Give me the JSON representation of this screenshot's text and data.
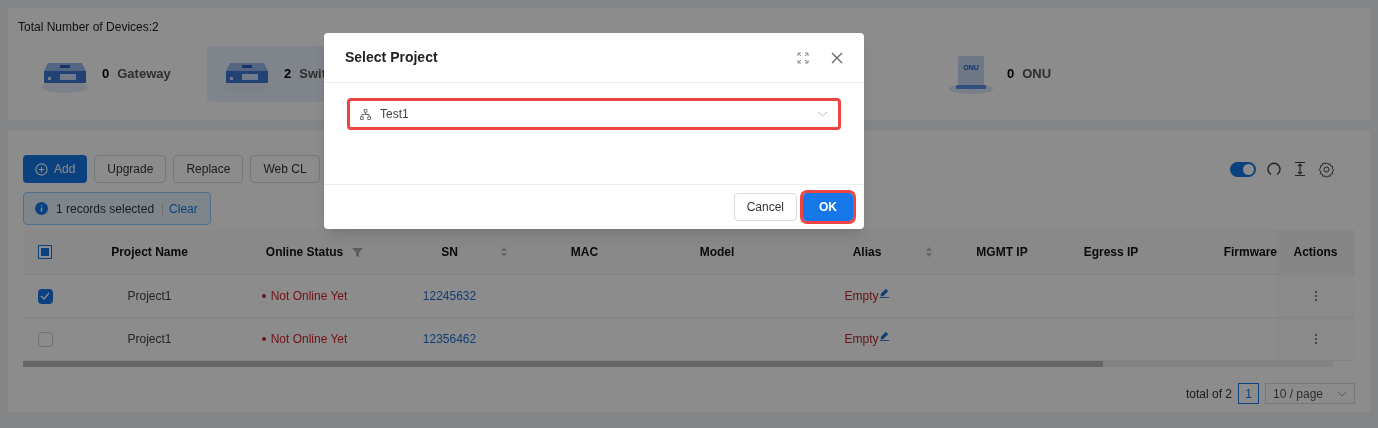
{
  "summary": {
    "title": "Total Number of Devices:2",
    "device_types": [
      {
        "kind": "gateway",
        "count": "0",
        "label": "Gateway",
        "selected": false
      },
      {
        "kind": "switch",
        "count": "2",
        "label": "Swit",
        "selected": true
      },
      {
        "kind": "onu",
        "count": "0",
        "label": "ONU",
        "selected": false,
        "icon_text": "ONU"
      }
    ]
  },
  "toolbar": {
    "buttons": [
      {
        "label": "Add",
        "kind": "primary"
      },
      {
        "label": "Upgrade",
        "kind": "default"
      },
      {
        "label": "Replace",
        "kind": "default"
      },
      {
        "label": "Web CL",
        "kind": "default"
      }
    ],
    "auto_refresh_on": true
  },
  "selection_bar": {
    "text": "1 records selected",
    "action": "Clear"
  },
  "table": {
    "header_checkbox_partial": true,
    "columns": [
      {
        "label": "Project Name",
        "sortable": false,
        "filterable": false
      },
      {
        "label": "Online Status",
        "sortable": false,
        "filterable": true
      },
      {
        "label": "SN",
        "sortable": true,
        "filterable": false
      },
      {
        "label": "MAC",
        "sortable": false,
        "filterable": false
      },
      {
        "label": "Model",
        "sortable": false,
        "filterable": false
      },
      {
        "label": "Alias",
        "sortable": true,
        "filterable": false
      },
      {
        "label": "MGMT IP",
        "sortable": false,
        "filterable": false
      },
      {
        "label": "Egress IP",
        "sortable": false,
        "filterable": false
      },
      {
        "label": "Firmware",
        "sortable": false,
        "filterable": false
      },
      {
        "label": "Actions",
        "sortable": false,
        "filterable": false
      }
    ],
    "rows": [
      {
        "checked": true,
        "project_name": "Project1",
        "online_status": "Not Online Yet",
        "sn": "12245632",
        "alias": "Empty"
      },
      {
        "checked": false,
        "project_name": "Project1",
        "online_status": "Not Online Yet",
        "sn": "12356462",
        "alias": "Empty"
      }
    ]
  },
  "pagination": {
    "total": "total of 2",
    "pages": [
      {
        "label": "1",
        "selected": true
      }
    ],
    "page_size": "10 / page"
  },
  "dialog": {
    "title": "Select Project",
    "project_select": {
      "value": "Test1",
      "highlighted": true
    },
    "buttons": [
      {
        "label": "Cancel",
        "kind": "default",
        "highlighted": false
      },
      {
        "label": "OK",
        "kind": "primary",
        "highlighted": true
      }
    ]
  }
}
